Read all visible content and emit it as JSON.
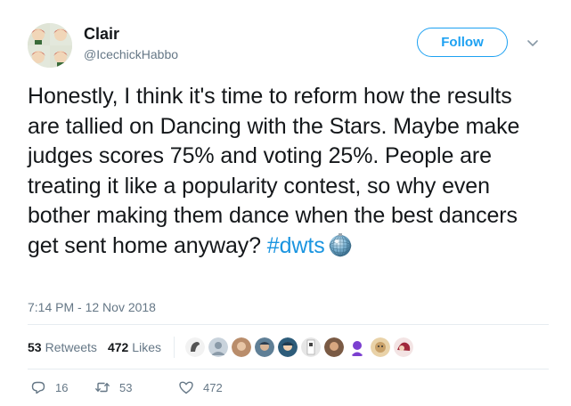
{
  "tweet": {
    "author": {
      "name": "Clair",
      "handle": "@IcechickHabbo"
    },
    "follow_label": "Follow",
    "text_main": "Honestly, I think it's time to reform how the results are tallied on Dancing with the Stars. Maybe make judges scores 75% and voting 25%. People are treating it like a popularity contest, so why even bother making them dance when the best dancers get sent home anyway? ",
    "hashtag": "#dwts",
    "timestamp": "7:14 PM - 12 Nov 2018",
    "stats": {
      "retweets_count": "53",
      "retweets_label": "Retweets",
      "likes_count": "472",
      "likes_label": "Likes"
    },
    "actions": {
      "replies": "16",
      "retweets": "53",
      "likes": "472"
    }
  },
  "colors": {
    "accent": "#1da1f2",
    "link": "#1b95e0",
    "muted": "#657786",
    "text": "#14171a"
  },
  "icons": [
    "chevron-down-icon",
    "disco-ball-emoji",
    "reply-icon",
    "retweet-icon",
    "heart-icon"
  ]
}
